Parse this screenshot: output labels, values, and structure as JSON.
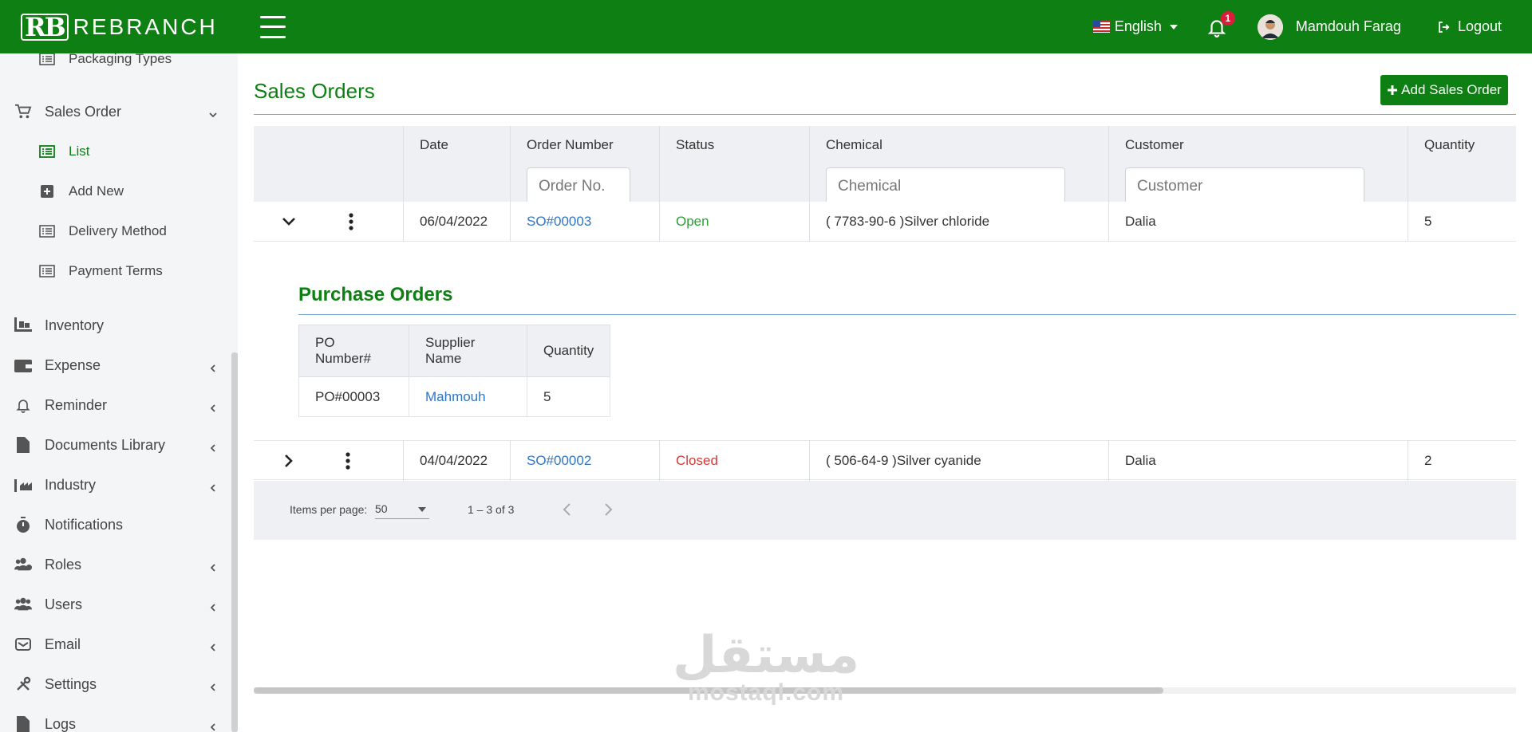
{
  "brand": {
    "mark": "RB",
    "name": "REBRANCH"
  },
  "header": {
    "language": "English",
    "notification_count": "1",
    "user_name": "Mamdouh Farag",
    "logout_label": "Logout"
  },
  "sidebar": {
    "items": [
      {
        "label": "Packaging Types",
        "icon": "list-icon"
      },
      {
        "label": "Sales Order",
        "icon": "cart-icon"
      },
      {
        "label": "List",
        "icon": "list-icon"
      },
      {
        "label": "Add New",
        "icon": "plus-square-icon"
      },
      {
        "label": "Delivery Method",
        "icon": "list-icon"
      },
      {
        "label": "Payment Terms",
        "icon": "list-icon"
      },
      {
        "label": "Inventory",
        "icon": "pallet-icon"
      },
      {
        "label": "Expense",
        "icon": "wallet-icon"
      },
      {
        "label": "Reminder",
        "icon": "bell-icon"
      },
      {
        "label": "Documents Library",
        "icon": "file-icon"
      },
      {
        "label": "Industry",
        "icon": "industry-icon"
      },
      {
        "label": "Notifications",
        "icon": "stopwatch-icon"
      },
      {
        "label": "Roles",
        "icon": "users-cog-icon"
      },
      {
        "label": "Users",
        "icon": "users-icon"
      },
      {
        "label": "Email",
        "icon": "mail-icon"
      },
      {
        "label": "Settings",
        "icon": "tools-icon"
      },
      {
        "label": "Logs",
        "icon": "file-icon"
      }
    ]
  },
  "main": {
    "title": "Sales Orders",
    "add_button": "Add Sales Order",
    "columns": [
      "Date",
      "Order Number",
      "Status",
      "Chemical",
      "Customer",
      "Quantity"
    ],
    "filters": {
      "order_placeholder": "Order No.",
      "chemical_placeholder": "Chemical",
      "customer_placeholder": "Customer"
    },
    "rows": [
      {
        "date": "06/04/2022",
        "order": "SO#00003",
        "status": "Open",
        "chemical": "( 7783-90-6 )Silver chloride",
        "customer": "Dalia",
        "quantity": "5"
      },
      {
        "date": "04/04/2022",
        "order": "SO#00002",
        "status": "Closed",
        "chemical": "( 506-64-9 )Silver cyanide",
        "customer": "Dalia",
        "quantity": "2"
      }
    ],
    "purchase_orders": {
      "title": "Purchase Orders",
      "columns": [
        "PO Number#",
        "Supplier Name",
        "Quantity"
      ],
      "rows": [
        {
          "po": "PO#00003",
          "supplier": "Mahmouh",
          "quantity": "5"
        }
      ]
    },
    "paginator": {
      "label": "Items per page:",
      "page_size": "50",
      "range": "1 – 3 of 3"
    }
  },
  "watermark": {
    "arabic": "مستقل",
    "latin": "mostaql.com"
  },
  "colors": {
    "brand_green": "#0e7f12",
    "link_blue": "#2f75c7",
    "open_green": "#2e9b3a",
    "closed_red": "#d23b3b"
  }
}
